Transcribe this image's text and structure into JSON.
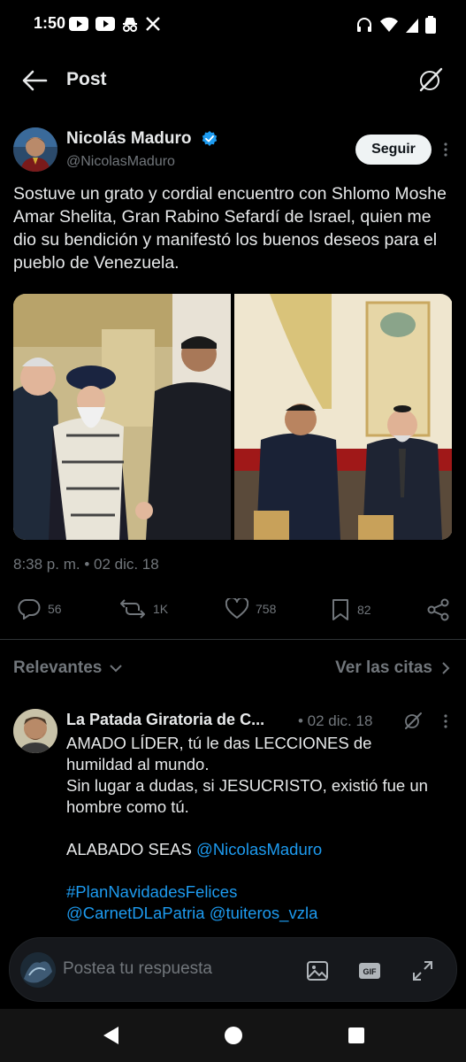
{
  "status_bar": {
    "time": "1:50",
    "left_icons": [
      "youtube-icon",
      "youtube-icon",
      "incognito-icon",
      "x-logo-icon"
    ],
    "right_icons": [
      "headphones-icon",
      "wifi-icon",
      "signal-icon",
      "battery-icon"
    ]
  },
  "header": {
    "title": "Post"
  },
  "post": {
    "author_name": "Nicolás Maduro",
    "handle": "@NicolasMaduro",
    "follow_label": "Seguir",
    "text": "Sostuve un grato y cordial encuentro con Shlomo Moshe Amar Shelita, Gran Rabino Sefardí de Israel, quien me dio su bendición y manifestó los buenos deseos para el pueblo de Venezuela.",
    "meta": "8:38 p. m. • 02 dic. 18",
    "stats": {
      "replies": "56",
      "reposts": "1K",
      "likes": "758",
      "bookmarks": "82"
    }
  },
  "replies_header": {
    "sort_label": "Relevantes",
    "quotes_label": "Ver las citas"
  },
  "reply": {
    "author_name": "La Patada Giratoria de C...",
    "date": "• 02 dic. 18",
    "lines": [
      "AMADO LÍDER, tú le das LECCIONES de",
      "humildad al mundo.",
      "Sin lugar a dudas, si JESUCRISTO, existió fue un",
      "hombre como tú.",
      "",
      "ALABADO SEAS ",
      "",
      ""
    ],
    "mention_1": "@NicolasMaduro",
    "hashtag": "#PlanNavidadesFelices",
    "mention_2": "@CarnetDLaPatria",
    "mention_3": "@tuiteros_vzla"
  },
  "composer": {
    "placeholder": "Postea tu respuesta",
    "gif_label": "GIF"
  },
  "colors": {
    "background": "#000000",
    "text": "#e7e9ea",
    "secondary": "#71767b",
    "link": "#1d9bf0",
    "verified": "#1d9bf0",
    "divider": "#2f3336"
  }
}
